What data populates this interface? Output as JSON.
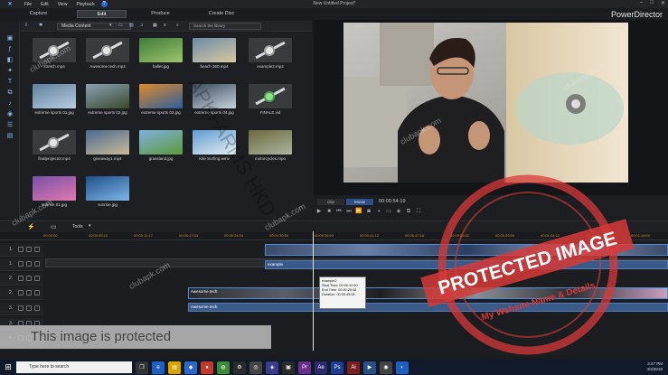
{
  "menu": {
    "items": [
      "File",
      "Edit",
      "View",
      "Playback"
    ],
    "help": "?"
  },
  "window": {
    "title": "New Untitled Project*",
    "brand": "PowerDirector",
    "controls": [
      "–",
      "□",
      "✕"
    ]
  },
  "modes": [
    {
      "label": "Capture"
    },
    {
      "label": "Edit",
      "active": true
    },
    {
      "label": "Produce"
    },
    {
      "label": "Create Disc"
    }
  ],
  "library": {
    "content_type": "Media Content",
    "search_placeholder": "Search the library",
    "items": [
      {
        "name": "stretch.mp4",
        "kind": "slider"
      },
      {
        "name": "Awesome tech.mp4",
        "kind": "slider"
      },
      {
        "name": "ballet.jpg",
        "kind": "photo",
        "colors": [
          "#3e7a3a",
          "#9fc56a"
        ]
      },
      {
        "name": "beach 360.mp4",
        "kind": "photo",
        "colors": [
          "#6c8ba8",
          "#d9c8a0"
        ]
      },
      {
        "name": "example2.mp4",
        "kind": "slider"
      },
      {
        "name": "extreme sports 01.jpg",
        "kind": "photo",
        "colors": [
          "#5f7f9c",
          "#b9cde0"
        ]
      },
      {
        "name": "extreme sports 02.jpg",
        "kind": "photo",
        "colors": [
          "#8aa0b4",
          "#394a2d"
        ]
      },
      {
        "name": "extreme sports 03.jpg",
        "kind": "photo",
        "colors": [
          "#e08a2a",
          "#2d5f9c"
        ]
      },
      {
        "name": "extreme sports 04.jpg",
        "kind": "photo",
        "colors": [
          "#3b4a5e",
          "#c7d2db"
        ]
      },
      {
        "name": "FINALE.vid",
        "kind": "slider",
        "green": true
      },
      {
        "name": "finalprojector.mp4",
        "kind": "slider"
      },
      {
        "name": "giveaway1.mp4",
        "kind": "photo",
        "colors": [
          "#4b6a8f",
          "#c9b99a"
        ]
      },
      {
        "name": "grassland.jpg",
        "kind": "photo",
        "colors": [
          "#7fb0de",
          "#5c9a3c"
        ]
      },
      {
        "name": "Kite Surfing.wmv",
        "kind": "photo",
        "colors": [
          "#5f9bd0",
          "#e7eef3"
        ]
      },
      {
        "name": "motorcycles.mpo",
        "kind": "photo",
        "colors": [
          "#6c6a3e",
          "#aab4a0"
        ]
      },
      {
        "name": "sunrise 01.jpg",
        "kind": "photo",
        "colors": [
          "#7a4fa6",
          "#e07ab0"
        ]
      },
      {
        "name": "sunrise.jpg",
        "kind": "photo",
        "colors": [
          "#1e4f8a",
          "#7fb6e6"
        ]
      }
    ]
  },
  "player": {
    "clip_label": "Clip",
    "movie_label": "Movie",
    "timecode": "00:00:54:10"
  },
  "timeline": {
    "tools_label": "Tools",
    "ruler": [
      "00:00:00",
      "00:00:05:10",
      "00:00:11:17",
      "00:00:17:03",
      "00:00:24:04",
      "00:00:30:05",
      "00:00:36:00",
      "00:00:41:12",
      "00:00:47:18",
      "00:00:53:02",
      "00:00:59:05",
      "00:01:04:12",
      "00:01:10:16",
      "00:01:16:00"
    ],
    "tracks": [
      "1.",
      "1.",
      "2.",
      "2.",
      "3.",
      "3.",
      "4."
    ],
    "clips": {
      "example": "example",
      "awesome": "Awesome tech",
      "awesome_audio": "Awesome tech"
    },
    "tooltip": {
      "name": "example2",
      "start": "Start Time: 00:00:10:00",
      "end": "End Time: 00:00:25:08",
      "duration": "Duration: 00:00:45:08"
    }
  },
  "watermark": {
    "protected_text": "This image is protected",
    "stamp_title": "PROTECTED IMAGE",
    "stamp_sub": "My Website Name & Details",
    "site": "clubapk.com",
    "diagonal": "APKFARMS HKD"
  },
  "taskbar": {
    "search_placeholder": "Type here to search",
    "time": "3:47 PM",
    "date": "4/3/2018"
  },
  "colors": {
    "accent": "#2e4f84",
    "ruler": "#c88a2e",
    "stamp": "#d73a3a"
  }
}
